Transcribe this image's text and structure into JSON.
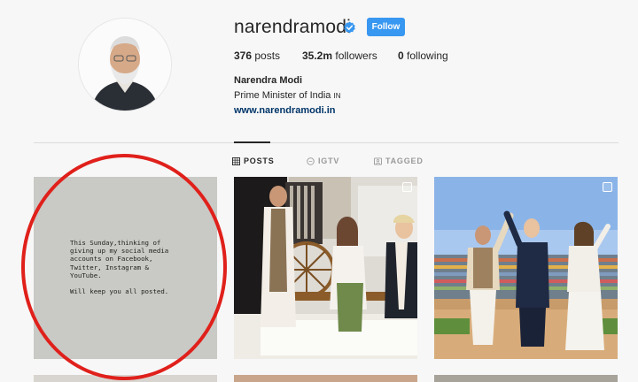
{
  "profile": {
    "username": "narendramodi",
    "verified": true,
    "follow_label": "Follow",
    "posts_count": "376",
    "posts_label": "posts",
    "followers_count": "35.2m",
    "followers_label": "followers",
    "following_count": "0",
    "following_label": "following",
    "full_name": "Narendra Modi",
    "bio_title": "Prime Minister of India",
    "bio_flag": "IN",
    "website": "www.narendramodi.in"
  },
  "tabs": [
    {
      "label": "POSTS",
      "active": true
    },
    {
      "label": "IGTV",
      "active": false
    },
    {
      "label": "TAGGED",
      "active": false
    }
  ],
  "posts": [
    {
      "type": "text-note",
      "text": "This Sunday,thinking of\ngiving up my social media\naccounts on Facebook,\nTwitter, Instagram &\nYouTube.\n\nWill keep you all posted."
    },
    {
      "type": "photo",
      "alt": "charkha"
    },
    {
      "type": "photo",
      "alt": "stadium"
    }
  ],
  "colors": {
    "accent": "#3897f0",
    "link": "#003569",
    "annotation": "#e0201b",
    "background": "#f7f7f7"
  }
}
